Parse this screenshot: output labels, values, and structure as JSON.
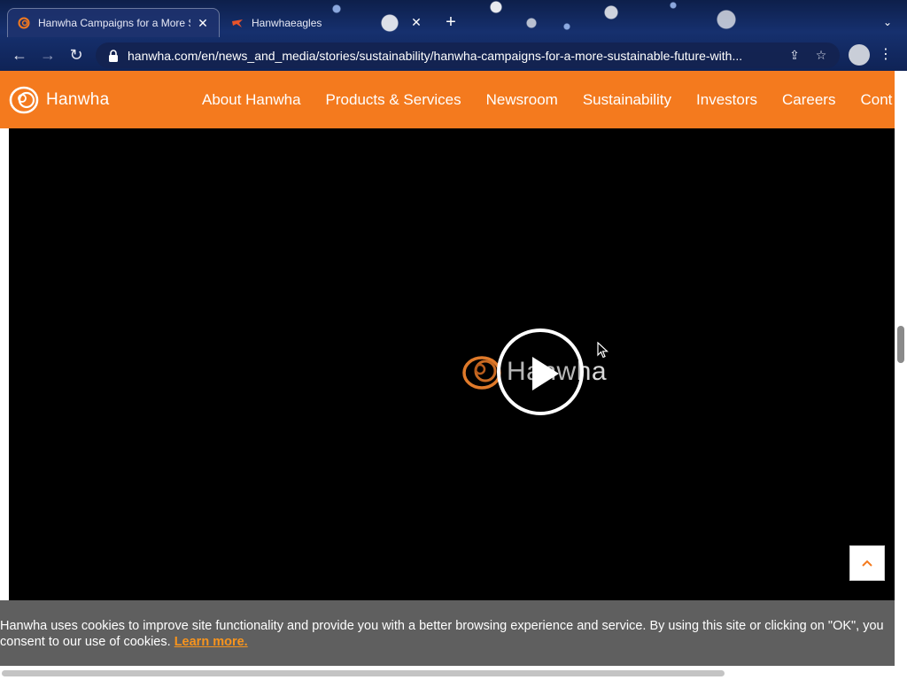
{
  "browser": {
    "tabs": [
      {
        "title": "Hanwha Campaigns for a More Sustainable Future",
        "active": true,
        "close_label": "✕"
      },
      {
        "title": "Hanwhaeagles",
        "active": false,
        "close_label": "✕"
      }
    ],
    "new_tab_label": "+",
    "tab_menu_label": "⌄",
    "url": "hanwha.com/en/news_and_media/stories/sustainability/hanwha-campaigns-for-a-more-sustainable-future-with..."
  },
  "site": {
    "brand": "Hanwha",
    "brand_color": "#f47a1e",
    "nav": [
      {
        "label": "About Hanwha"
      },
      {
        "label": "Products & Services"
      },
      {
        "label": "Newsroom"
      },
      {
        "label": "Sustainability"
      },
      {
        "label": "Investors"
      },
      {
        "label": "Careers"
      },
      {
        "label": "Cont"
      }
    ]
  },
  "video": {
    "logo_text": "Hanwha",
    "play_icon": "play-icon"
  },
  "to_top_icon": "chevron-up-icon",
  "cookie": {
    "message": "Hanwha uses cookies to improve site functionality and provide you with a better browsing experience and service. By using this site or clicking on \"OK\", you consent to our use of cookies.",
    "link_label": "Learn more.",
    "link_color": "#f7941d"
  }
}
